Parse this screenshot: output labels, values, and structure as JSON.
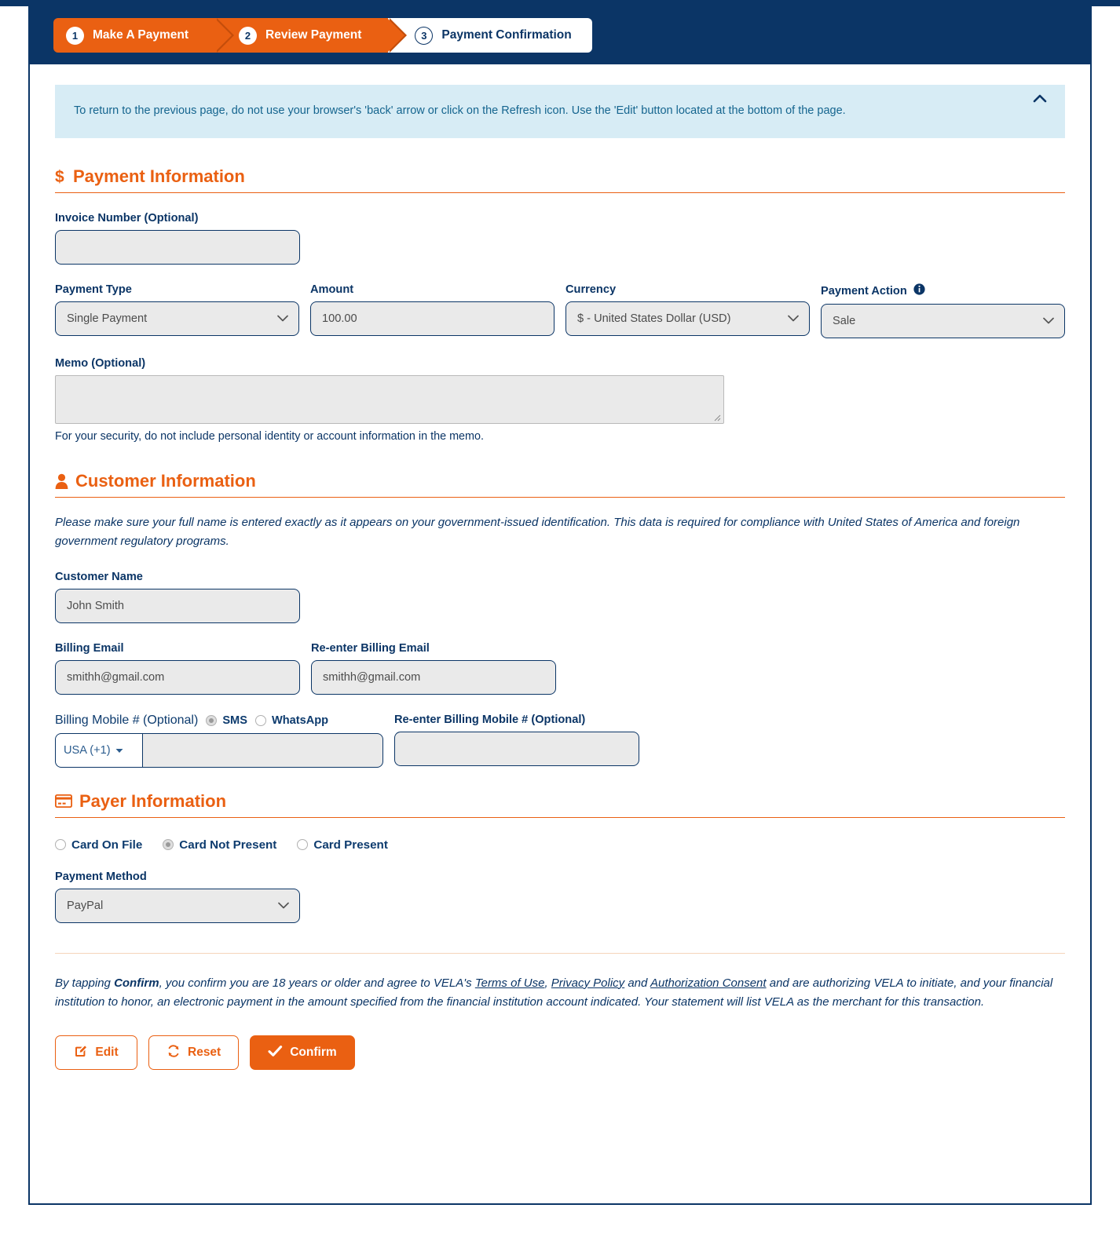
{
  "theme": {
    "navy": "#0b3566",
    "orange": "#ea6012",
    "alert_bg": "#d7ecf5",
    "field_bg": "#eaeaea"
  },
  "stepper": {
    "steps": [
      {
        "num": "1",
        "label": "Make A Payment",
        "state": "active"
      },
      {
        "num": "2",
        "label": "Review Payment",
        "state": "active"
      },
      {
        "num": "3",
        "label": "Payment Confirmation",
        "state": "inactive"
      }
    ]
  },
  "alert": {
    "text": "To return to the previous page, do not use your browser's 'back' arrow or click on the Refresh icon. Use the 'Edit' button located at the bottom of the page.",
    "collapse_icon": "chevron-up-icon"
  },
  "payment_information": {
    "heading": "Payment Information",
    "icon": "dollar-sign-icon",
    "invoice_number": {
      "label": "Invoice Number (Optional)",
      "value": "",
      "placeholder": ""
    },
    "payment_type": {
      "label": "Payment Type",
      "value": "Single Payment",
      "options": [
        "Single Payment"
      ]
    },
    "amount": {
      "label": "Amount",
      "value": "100.00",
      "placeholder": ""
    },
    "currency": {
      "label": "Currency",
      "value": "$ - United States Dollar (USD)",
      "options": [
        "$ - United States Dollar (USD)"
      ]
    },
    "payment_action": {
      "label": "Payment Action",
      "value": "Sale",
      "options": [
        "Sale"
      ],
      "info_icon": "info-circle-icon"
    },
    "memo": {
      "label": "Memo (Optional)",
      "value": "",
      "hint": "For your security, do not include personal identity or account information in the memo."
    }
  },
  "customer_information": {
    "heading": "Customer Information",
    "icon": "person-icon",
    "note": "Please make sure your full name is entered exactly as it appears on your government-issued identification. This data is required for compliance with United States of America and foreign government regulatory programs.",
    "customer_name": {
      "label": "Customer Name",
      "value": "John Smith"
    },
    "billing_email": {
      "label": "Billing Email",
      "value": "smithh@gmail.com"
    },
    "reenter_billing_email": {
      "label": "Re-enter Billing Email",
      "value": "smithh@gmail.com"
    },
    "billing_mobile": {
      "label": "Billing Mobile # (Optional)",
      "country_code": "USA (+1)",
      "value": "",
      "channels": [
        {
          "label": "SMS",
          "selected": true
        },
        {
          "label": "WhatsApp",
          "selected": false
        }
      ]
    },
    "reenter_billing_mobile": {
      "label": "Re-enter Billing Mobile # (Optional)",
      "value": ""
    }
  },
  "payer_information": {
    "heading": "Payer Information",
    "icon": "credit-card-icon",
    "card_options": [
      {
        "label": "Card On File",
        "selected": false
      },
      {
        "label": "Card Not Present",
        "selected": true
      },
      {
        "label": "Card Present",
        "selected": false
      }
    ],
    "payment_method": {
      "label": "Payment Method",
      "value": "PayPal",
      "options": [
        "PayPal"
      ]
    }
  },
  "legal": {
    "part1": "By tapping ",
    "confirm_word": "Confirm",
    "part2": ", you confirm you are 18 years or older and agree to VELA's ",
    "link_terms": "Terms of Use",
    "sep1": ", ",
    "link_privacy": "Privacy Policy",
    "sep2": " and ",
    "link_auth": "Authorization Consent",
    "part3": " and are authorizing VELA to initiate, and your financial institution to honor, an electronic payment in the amount specified from the financial institution account indicated. Your statement will list VELA as the merchant for this transaction."
  },
  "actions": {
    "edit": {
      "label": "Edit",
      "icon": "edit-pencil-icon"
    },
    "reset": {
      "label": "Reset",
      "icon": "refresh-icon"
    },
    "confirm": {
      "label": "Confirm",
      "icon": "check-icon"
    }
  }
}
